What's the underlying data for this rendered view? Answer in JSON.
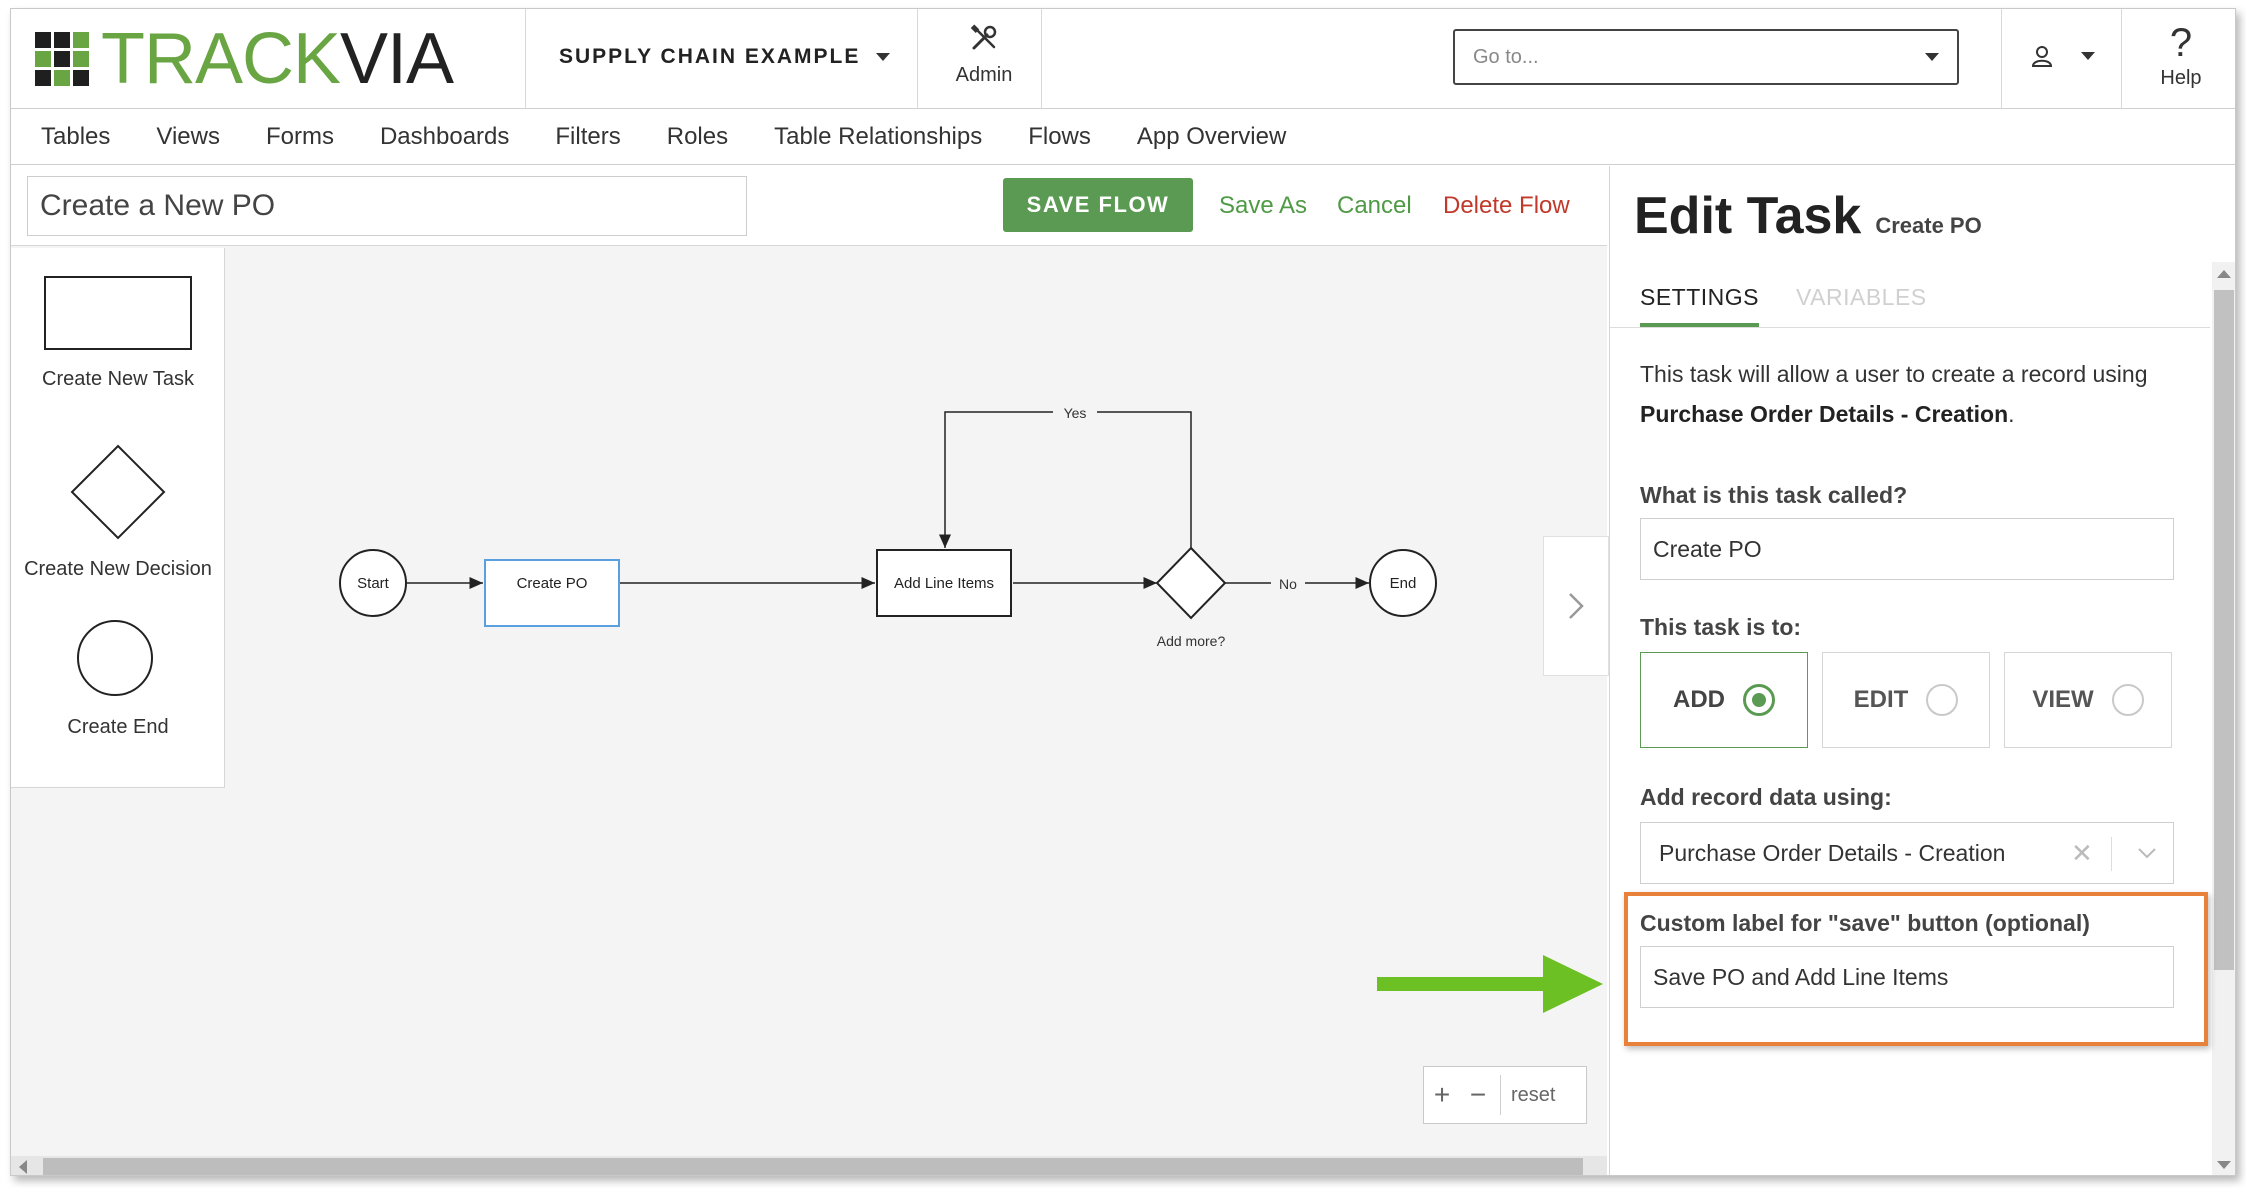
{
  "header": {
    "logo_track": "TRACK",
    "logo_via": "VIA",
    "logo_colors": [
      "#1f1f1f",
      "#1f1f1f",
      "#6aa544",
      "#6aa544",
      "#1f1f1f",
      "#6aa544",
      "#1f1f1f",
      "#6aa544",
      "#1f1f1f"
    ],
    "app_name": "SUPPLY CHAIN EXAMPLE",
    "admin_label": "Admin",
    "goto_placeholder": "Go to...",
    "help_label": "Help",
    "help_glyph": "?"
  },
  "nav": {
    "items": [
      {
        "label": "Tables"
      },
      {
        "label": "Views"
      },
      {
        "label": "Forms"
      },
      {
        "label": "Dashboards"
      },
      {
        "label": "Filters"
      },
      {
        "label": "Roles"
      },
      {
        "label": "Table Relationships"
      },
      {
        "label": "Flows"
      },
      {
        "label": "App Overview"
      }
    ]
  },
  "toolbar": {
    "flow_name": "Create a New PO",
    "save_flow": "SAVE FLOW",
    "save_as": "Save As",
    "cancel": "Cancel",
    "delete_flow": "Delete Flow"
  },
  "palette": {
    "task": "Create New Task",
    "decision": "Create New Decision",
    "end": "Create End"
  },
  "flow": {
    "start": "Start",
    "create_po": "Create PO",
    "add_line_items": "Add Line Items",
    "decision": "Add more?",
    "yes": "Yes",
    "no": "No",
    "end": "End"
  },
  "zoom": {
    "plus": "+",
    "minus": "−",
    "reset": "reset"
  },
  "panel": {
    "title": "Edit Task",
    "subtitle": "Create PO",
    "tab_settings": "SETTINGS",
    "tab_variables": "VARIABLES",
    "desc_prefix": "This task will allow a user to create a record using ",
    "desc_bold": "Purchase Order Details - Creation",
    "desc_suffix": ".",
    "name_label": "What is this task called?",
    "name_value": "Create PO",
    "type_label": "This task is to:",
    "options": [
      {
        "label": "ADD",
        "selected": true
      },
      {
        "label": "EDIT",
        "selected": false
      },
      {
        "label": "VIEW",
        "selected": false
      }
    ],
    "data_label": "Add record data using:",
    "data_value": "Purchase Order Details - Creation",
    "clear_glyph": "✕",
    "save_label_label": "Custom label for \"save\" button (optional)",
    "save_label_value": "Save PO and Add Line Items"
  },
  "colors": {
    "accent_green": "#5a9a52",
    "delete_red": "#c0392b",
    "highlight_orange": "#e8823a",
    "arrow_green": "#6cc024",
    "selected_node_blue": "#5aa0e0"
  }
}
